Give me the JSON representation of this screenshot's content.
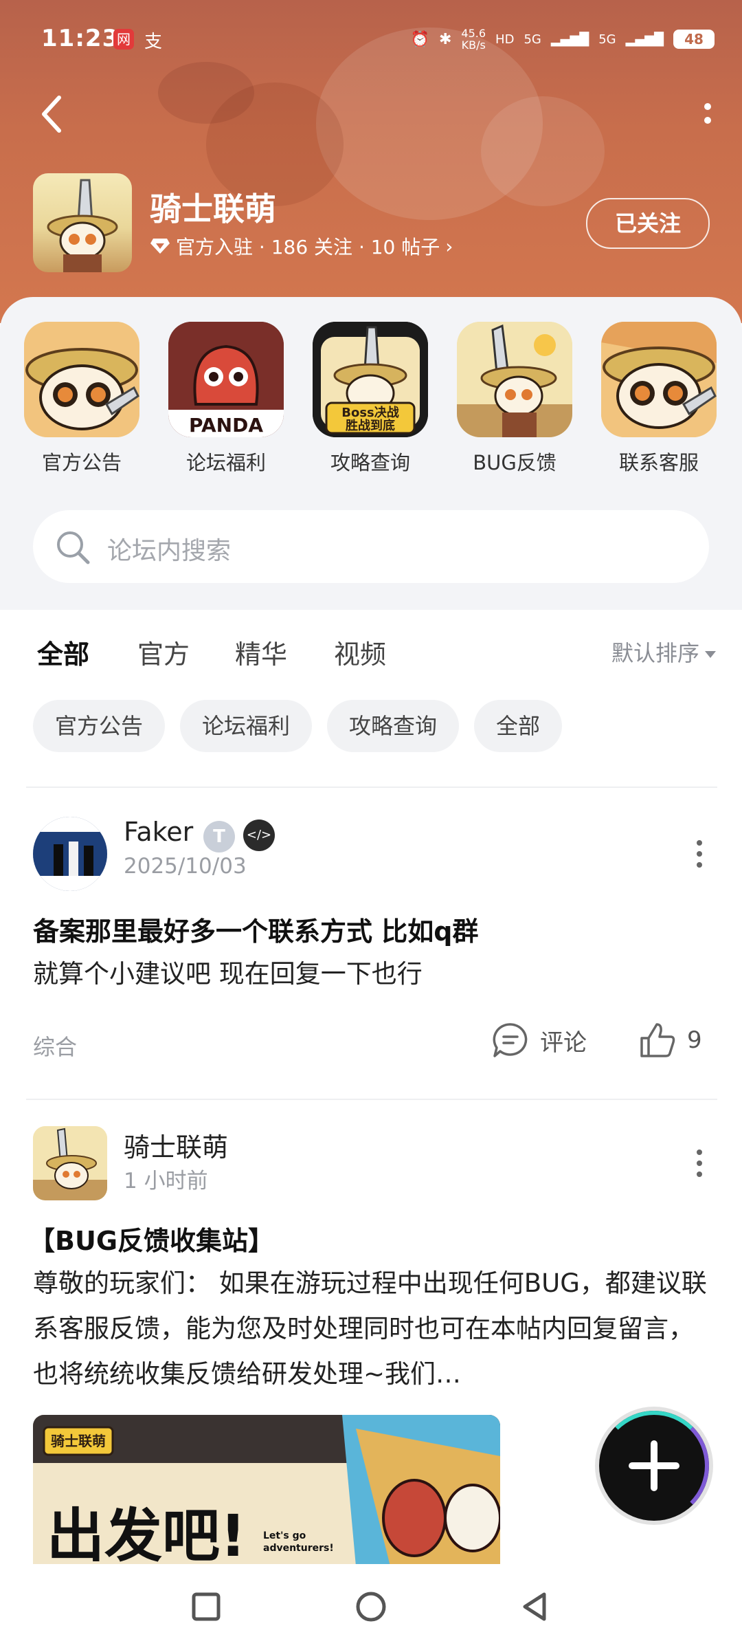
{
  "status_bar": {
    "time": "11:23",
    "app_icon_text": "网",
    "app2_text": "支",
    "net_speed_top": "45.6",
    "net_speed_bottom": "KB/s",
    "net_type_1": "5G",
    "net_type_2": "5G",
    "battery": "48"
  },
  "header": {
    "forum_name": "骑士联萌",
    "meta": "官方入驻 · 186 关注 · 10 帖子",
    "follow_label": "已关注"
  },
  "quick_links": [
    {
      "label": "官方公告",
      "icon": "panda-knight-icon"
    },
    {
      "label": "论坛福利",
      "icon": "panda-dragon-icon",
      "sub": "PANDA"
    },
    {
      "label": "攻略查询",
      "icon": "boss-guide-icon",
      "sub": "Boss决战\n胜战到底"
    },
    {
      "label": "BUG反馈",
      "icon": "knight-sword-icon"
    },
    {
      "label": "联系客服",
      "icon": "panda-support-icon"
    }
  ],
  "search": {
    "placeholder": "论坛内搜索"
  },
  "tabs": [
    {
      "label": "全部",
      "active": true
    },
    {
      "label": "官方"
    },
    {
      "label": "精华"
    },
    {
      "label": "视频"
    }
  ],
  "sort_label": "默认排序",
  "chips": [
    "官方公告",
    "论坛福利",
    "攻略查询",
    "全部"
  ],
  "posts": [
    {
      "author": "Faker",
      "time": "2025/10/03",
      "title": "备案那里最好多一个联系方式 比如q群",
      "body": "就算个小建议吧 现在回复一下也行",
      "tag": "综合",
      "comment_label": "评论",
      "likes": "9",
      "badge": "T"
    },
    {
      "author": "骑士联萌",
      "time": "1 小时前",
      "title": "【BUG反馈收集站】",
      "body": "尊敬的玩家们：  如果在游玩过程中出现任何BUG，都建议联系客服反馈，能为您及时处理同时也可在本帖内回复留言，也将统统收集反馈给研发处理~我们…",
      "image_logo_text": "骑士联萌",
      "image_text": "出发吧!",
      "image_sub": "Let's go adventurers!"
    }
  ],
  "colors": {
    "banner": "#c86e4c",
    "tab_indicator": "#2fd1c1",
    "fab": "#111111"
  }
}
